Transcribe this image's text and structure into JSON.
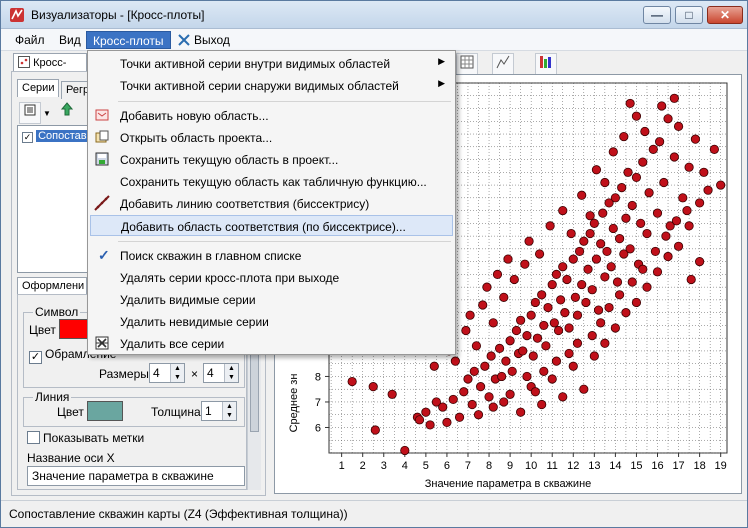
{
  "window": {
    "title": "Визуализаторы - [Кросс-плоты]",
    "min_glyph": "—",
    "max_glyph": "□",
    "close_glyph": "✕"
  },
  "menubar": {
    "file": "Файл",
    "view": "Вид",
    "crossplots": "Кросс-плоты",
    "exit": "Выход"
  },
  "left": {
    "top_tab": "Кросс-плоты",
    "tab_series": "Серии",
    "tab_regress": "Регр",
    "series_item": "Сопостав",
    "tab_format": "Оформлени",
    "symbol_group": "Символ",
    "color_label": "Цвет",
    "outline_label": "Обрамление",
    "sizes_label": "Размеры",
    "size_w": "4",
    "size_x": "×",
    "size_h": "4",
    "line_group": "Линия",
    "line_color_label": "Цвет",
    "thickness_label": "Толщина",
    "thickness_value": "1",
    "show_marks": "Показывать метки",
    "axis_name_label": "Название оси X",
    "axis_name_value": "Значение параметра в скважине",
    "symbol_color": "#ff0000",
    "line_color": "#6aa6a0"
  },
  "menu": {
    "items": [
      {
        "label": "Точки активной серии внутри видимых областей",
        "submenu": "▶"
      },
      {
        "label": "Точки активной серии снаружи видимых областей",
        "submenu": "▶"
      },
      {
        "label": "Добавить новую область..."
      },
      {
        "label": "Открыть область проекта..."
      },
      {
        "label": "Сохранить текущую область в проект..."
      },
      {
        "label": "Сохранить текущую область как табличную функцию..."
      },
      {
        "label": "Добавить линию соответствия (биссектрису)"
      },
      {
        "label": "Добавить область соответствия (по биссектрисе)..."
      },
      {
        "label": "Поиск скважин в главном списке",
        "checked": "✓"
      },
      {
        "label": "Удалять серии кросс-плота при выходе"
      },
      {
        "label": "Удалить видимые серии"
      },
      {
        "label": "Удалить невидимые серии"
      },
      {
        "label": "Удалить все серии"
      }
    ]
  },
  "chart_data": {
    "type": "scatter",
    "xlabel": "Значение параметра в скважине",
    "ylabel": "Среднее зн",
    "xlim": [
      1,
      19
    ],
    "ylim": [
      5,
      19
    ],
    "x_ticks": [
      "1",
      "2",
      "3",
      "4",
      "5",
      "6",
      "7",
      "8",
      "9",
      "10",
      "11",
      "12",
      "13",
      "14",
      "15",
      "16",
      "17",
      "18",
      "19"
    ],
    "y_ticks": [
      "6",
      "7",
      "8"
    ],
    "grid": true,
    "point_color": "#c0101a",
    "points": [
      [
        2.6,
        5.9
      ],
      [
        4.0,
        5.1
      ],
      [
        1.5,
        7.8
      ],
      [
        2.5,
        7.6
      ],
      [
        3.4,
        7.3
      ],
      [
        4.6,
        6.4
      ],
      [
        4.7,
        6.3
      ],
      [
        5.0,
        6.6
      ],
      [
        5.2,
        6.1
      ],
      [
        5.5,
        7.0
      ],
      [
        5.8,
        6.8
      ],
      [
        6.0,
        6.2
      ],
      [
        6.3,
        7.1
      ],
      [
        6.6,
        6.4
      ],
      [
        6.8,
        7.4
      ],
      [
        7.0,
        7.9
      ],
      [
        7.2,
        6.9
      ],
      [
        7.3,
        8.2
      ],
      [
        7.6,
        7.6
      ],
      [
        7.8,
        8.4
      ],
      [
        8.0,
        7.2
      ],
      [
        8.1,
        8.8
      ],
      [
        8.3,
        7.9
      ],
      [
        8.5,
        9.1
      ],
      [
        8.6,
        8.0
      ],
      [
        8.8,
        8.6
      ],
      [
        9.0,
        9.4
      ],
      [
        9.1,
        8.2
      ],
      [
        9.3,
        9.8
      ],
      [
        9.4,
        8.9
      ],
      [
        9.5,
        10.2
      ],
      [
        9.6,
        9.0
      ],
      [
        9.8,
        9.6
      ],
      [
        10.0,
        10.4
      ],
      [
        10.1,
        8.8
      ],
      [
        10.2,
        10.9
      ],
      [
        10.3,
        9.5
      ],
      [
        10.5,
        11.2
      ],
      [
        10.6,
        10.0
      ],
      [
        10.7,
        9.2
      ],
      [
        10.8,
        10.7
      ],
      [
        11.0,
        11.6
      ],
      [
        11.1,
        10.1
      ],
      [
        11.2,
        12.0
      ],
      [
        11.3,
        9.8
      ],
      [
        11.4,
        11.0
      ],
      [
        11.5,
        12.3
      ],
      [
        11.6,
        10.5
      ],
      [
        11.7,
        11.8
      ],
      [
        11.8,
        9.9
      ],
      [
        12.0,
        12.6
      ],
      [
        12.1,
        11.1
      ],
      [
        12.2,
        10.4
      ],
      [
        12.3,
        12.9
      ],
      [
        12.4,
        11.6
      ],
      [
        12.5,
        13.3
      ],
      [
        12.6,
        10.9
      ],
      [
        12.7,
        12.2
      ],
      [
        12.8,
        13.6
      ],
      [
        12.9,
        11.4
      ],
      [
        13.0,
        14.0
      ],
      [
        13.1,
        12.6
      ],
      [
        13.2,
        10.6
      ],
      [
        13.3,
        13.2
      ],
      [
        13.4,
        14.4
      ],
      [
        13.5,
        11.9
      ],
      [
        13.6,
        12.9
      ],
      [
        13.7,
        14.8
      ],
      [
        13.8,
        12.3
      ],
      [
        13.9,
        13.8
      ],
      [
        14.0,
        15.0
      ],
      [
        14.1,
        11.7
      ],
      [
        14.2,
        13.4
      ],
      [
        14.3,
        15.4
      ],
      [
        14.4,
        12.8
      ],
      [
        14.5,
        14.2
      ],
      [
        14.6,
        16.0
      ],
      [
        14.7,
        13.0
      ],
      [
        14.8,
        14.7
      ],
      [
        15.0,
        15.8
      ],
      [
        15.1,
        12.4
      ],
      [
        15.2,
        14.0
      ],
      [
        15.3,
        16.4
      ],
      [
        15.5,
        13.6
      ],
      [
        15.6,
        15.2
      ],
      [
        15.8,
        16.9
      ],
      [
        16.0,
        14.4
      ],
      [
        16.1,
        17.2
      ],
      [
        16.3,
        15.6
      ],
      [
        16.5,
        18.1
      ],
      [
        16.6,
        13.9
      ],
      [
        16.8,
        16.6
      ],
      [
        17.0,
        17.8
      ],
      [
        17.2,
        15.0
      ],
      [
        17.5,
        16.2
      ],
      [
        17.8,
        17.3
      ],
      [
        18.0,
        14.8
      ],
      [
        18.2,
        16.0
      ],
      [
        18.7,
        16.9
      ],
      [
        19.0,
        15.5
      ],
      [
        5.4,
        8.4
      ],
      [
        6.1,
        9.0
      ],
      [
        6.4,
        8.6
      ],
      [
        6.9,
        9.8
      ],
      [
        7.1,
        10.4
      ],
      [
        7.4,
        9.2
      ],
      [
        7.7,
        10.8
      ],
      [
        7.9,
        11.5
      ],
      [
        8.2,
        10.1
      ],
      [
        8.4,
        12.0
      ],
      [
        8.7,
        11.1
      ],
      [
        8.9,
        12.6
      ],
      [
        9.2,
        11.8
      ],
      [
        9.7,
        12.4
      ],
      [
        9.9,
        13.3
      ],
      [
        10.4,
        12.8
      ],
      [
        10.9,
        13.9
      ],
      [
        11.5,
        14.5
      ],
      [
        11.9,
        13.6
      ],
      [
        12.4,
        15.1
      ],
      [
        12.8,
        14.3
      ],
      [
        13.1,
        16.1
      ],
      [
        13.5,
        15.6
      ],
      [
        13.9,
        16.8
      ],
      [
        14.4,
        17.4
      ],
      [
        15.0,
        18.2
      ],
      [
        15.4,
        17.6
      ],
      [
        16.2,
        18.6
      ],
      [
        16.8,
        18.9
      ],
      [
        14.7,
        18.7
      ],
      [
        9.0,
        7.3
      ],
      [
        9.5,
        6.6
      ],
      [
        10.0,
        7.6
      ],
      [
        10.5,
        6.9
      ],
      [
        11.0,
        7.9
      ],
      [
        11.5,
        7.2
      ],
      [
        12.0,
        8.4
      ],
      [
        12.5,
        7.5
      ],
      [
        13.0,
        8.8
      ],
      [
        13.5,
        9.3
      ],
      [
        14.0,
        9.9
      ],
      [
        14.5,
        10.5
      ],
      [
        15.0,
        10.9
      ],
      [
        15.5,
        11.5
      ],
      [
        16.0,
        12.1
      ],
      [
        16.5,
        12.7
      ],
      [
        17.0,
        13.1
      ],
      [
        17.5,
        13.9
      ],
      [
        18.0,
        12.5
      ],
      [
        17.6,
        11.8
      ],
      [
        7.5,
        6.5
      ],
      [
        8.2,
        6.8
      ],
      [
        8.7,
        7.0
      ],
      [
        9.8,
        8.0
      ],
      [
        10.2,
        7.4
      ],
      [
        10.6,
        8.2
      ],
      [
        11.2,
        8.6
      ],
      [
        11.8,
        8.9
      ],
      [
        12.2,
        9.3
      ],
      [
        12.9,
        9.6
      ],
      [
        13.3,
        10.1
      ],
      [
        13.7,
        10.7
      ],
      [
        14.2,
        11.2
      ],
      [
        14.8,
        11.7
      ],
      [
        15.3,
        12.2
      ],
      [
        15.9,
        12.9
      ],
      [
        16.4,
        13.5
      ],
      [
        16.9,
        14.1
      ],
      [
        17.4,
        14.5
      ],
      [
        18.4,
        15.3
      ]
    ]
  },
  "status": {
    "text": "Сопоставление скважин карты (Z4 (Эффективная толщина))"
  }
}
